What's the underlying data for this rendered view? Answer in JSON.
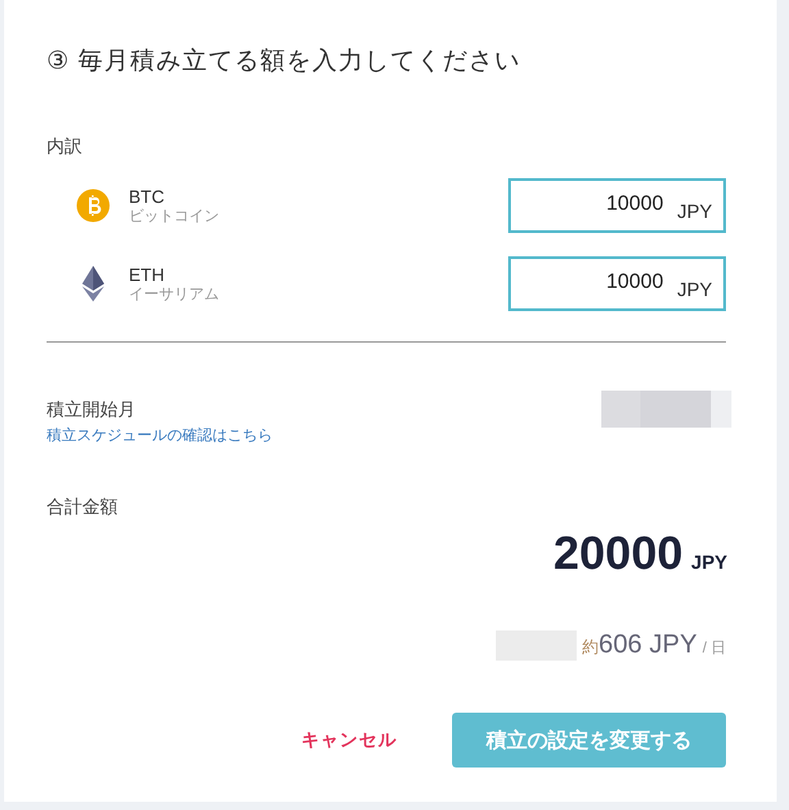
{
  "title": "③ 毎月積み立てる額を入力してください",
  "breakdown": {
    "label": "内訳",
    "items": [
      {
        "kind": "btc",
        "symbol": "BTC",
        "name": "ビットコイン",
        "value": "10000",
        "unit": "JPY"
      },
      {
        "kind": "eth",
        "symbol": "ETH",
        "name": "イーサリアム",
        "value": "10000",
        "unit": "JPY"
      }
    ]
  },
  "start_month": {
    "label": "積立開始月",
    "link": "積立スケジュールの確認はこちら"
  },
  "total": {
    "label": "合計金額",
    "amount": "20000",
    "unit": "JPY",
    "approx_prefix": "約",
    "daily_amount": "606 JPY",
    "daily_suffix": "/ 日"
  },
  "buttons": [
    {
      "kind": "cancel",
      "label": "キャンセル"
    },
    {
      "kind": "primary",
      "label": "積立の設定を変更する"
    }
  ]
}
